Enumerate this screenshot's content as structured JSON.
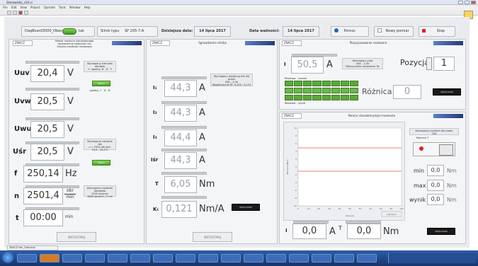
{
  "window": {
    "title": "Stanowisko_v10.vi"
  },
  "menu": [
    "File",
    "Edit",
    "View",
    "Project",
    "Operate",
    "Tools",
    "Window",
    "Help"
  ],
  "header": {
    "board": "DaqBoard3000_Obecna?",
    "toggle_label": "tak",
    "motor_label": "Silnik typu",
    "motor_type": "SP 205-7-A",
    "today_label": "Dzisiejsza data:",
    "today_value": "14 lipca 2017",
    "valid_label": "Data ważności:",
    "valid_value": "14 lipca 2017",
    "help_label": "Pomoc",
    "new_label": "Nowy pomiar",
    "stop_label": "Stop"
  },
  "panel1": {
    "znacz": "ZNACZ",
    "title": "Pomiar napięcia indukowanego\nSprawdzenie kolejności faz\nZmylka prędkości obrotowej",
    "rows": [
      {
        "label": "Uuv",
        "value": "20,4",
        "unit": "V"
      },
      {
        "label": "Uvw",
        "value": "20,5",
        "unit": "V"
      },
      {
        "label": "Uwu",
        "value": "20,5",
        "unit": "V"
      },
      {
        "label": "Uśr",
        "value": "20,5",
        "unit": "V"
      },
      {
        "label": "f",
        "value": "250,14",
        "unit": "Hz"
      },
      {
        "label": "n",
        "value": "2501,4",
        "unit_top": "obr",
        "unit_bottom": "min"
      },
      {
        "label": "t",
        "value": "00:00",
        "unit": "min"
      }
    ],
    "note1": "Wymagany kierunek obrotów\n+: zgodny, B - D - F",
    "note1_status": "zgodny, F - D - B",
    "note2": "Wymagane napięcie dla\nn = 2500 obr/min\n19,5 - 24,5 V",
    "note3": "Wymagana prędkość obrotowa\n2500 obr/min\n4800 obr/min, 2 min",
    "btn_small": "Status",
    "stop": "WSTRZYMAJ"
  },
  "panel2": {
    "znacz": "ZNACZ",
    "title": "Sprawdzenie silnika",
    "rows": [
      {
        "label": "I₁",
        "value": "44,3",
        "unit": "A"
      },
      {
        "label": "I₂",
        "value": "44,3",
        "unit": "A"
      },
      {
        "label": "I₃",
        "value": "44,4",
        "unit": "A"
      },
      {
        "label": "Iśr",
        "value": "44,3",
        "unit": "A"
      },
      {
        "label": "T",
        "value": "6,05",
        "unit": "Nm"
      },
      {
        "label": "Kₜ",
        "value": "0,121",
        "unit": "Nm/A"
      }
    ],
    "note": "Wymagany współczynnik dla prądu\n44A - 1,0A\nWspółczynnik KT: 0,109 - 0,131",
    "black": "WEJŚCIOWE",
    "stop": "WSTRZYMAJ"
  },
  "panel3": {
    "znacz": "ZNACZ",
    "title": "Pozycjonowanie resolwera",
    "i_label": "I",
    "i_value": "50,5",
    "i_unit": "A",
    "note": "Wymagany prąd\n40A - 1,0A\nMaksymalne ustawienie 3b",
    "pos_label": "Pozycja",
    "pos_value": "1",
    "diff_label": "Różnica",
    "diff_value": "0",
    "leds_top_label": "Resolwer - pomiar",
    "leds_bottom_label": "Resolwer - wynik",
    "black": "WEJŚCIOWE"
  },
  "panel4": {
    "znacz": "ZNACZ",
    "title": "Pomiar charakterystyki momentu",
    "ylabel": "Moment [Nm]",
    "xlabel": "Czas [s]",
    "yticks": [
      "10",
      "8",
      "6",
      "4",
      "2",
      "0",
      "-2",
      "-4",
      "-6",
      "-8",
      "-10"
    ],
    "xticks": [
      "0",
      "10",
      "20",
      "30",
      "40",
      "50",
      "60",
      "70",
      "80",
      "90",
      "100"
    ],
    "xunit": "[d] 10 m",
    "note": "Wymagany moment dla prądu\n10A",
    "moment_label": "Moment T",
    "min_label": "min",
    "min_value": "0,0",
    "max_label": "max",
    "max_value": "0,0",
    "res_label": "wynik",
    "res_value": "0,0",
    "unit": "Nm",
    "bottom_i_label": "I",
    "bottom_i_value": "0,0",
    "bottom_i_unit": "A",
    "bottom_t_label": "T",
    "bottom_t_value": "0,0",
    "bottom_t_unit": "Nm",
    "black": "WEJŚCIOWE"
  },
  "status": {
    "left": "ZNACZ Nm_Odmiana"
  }
}
